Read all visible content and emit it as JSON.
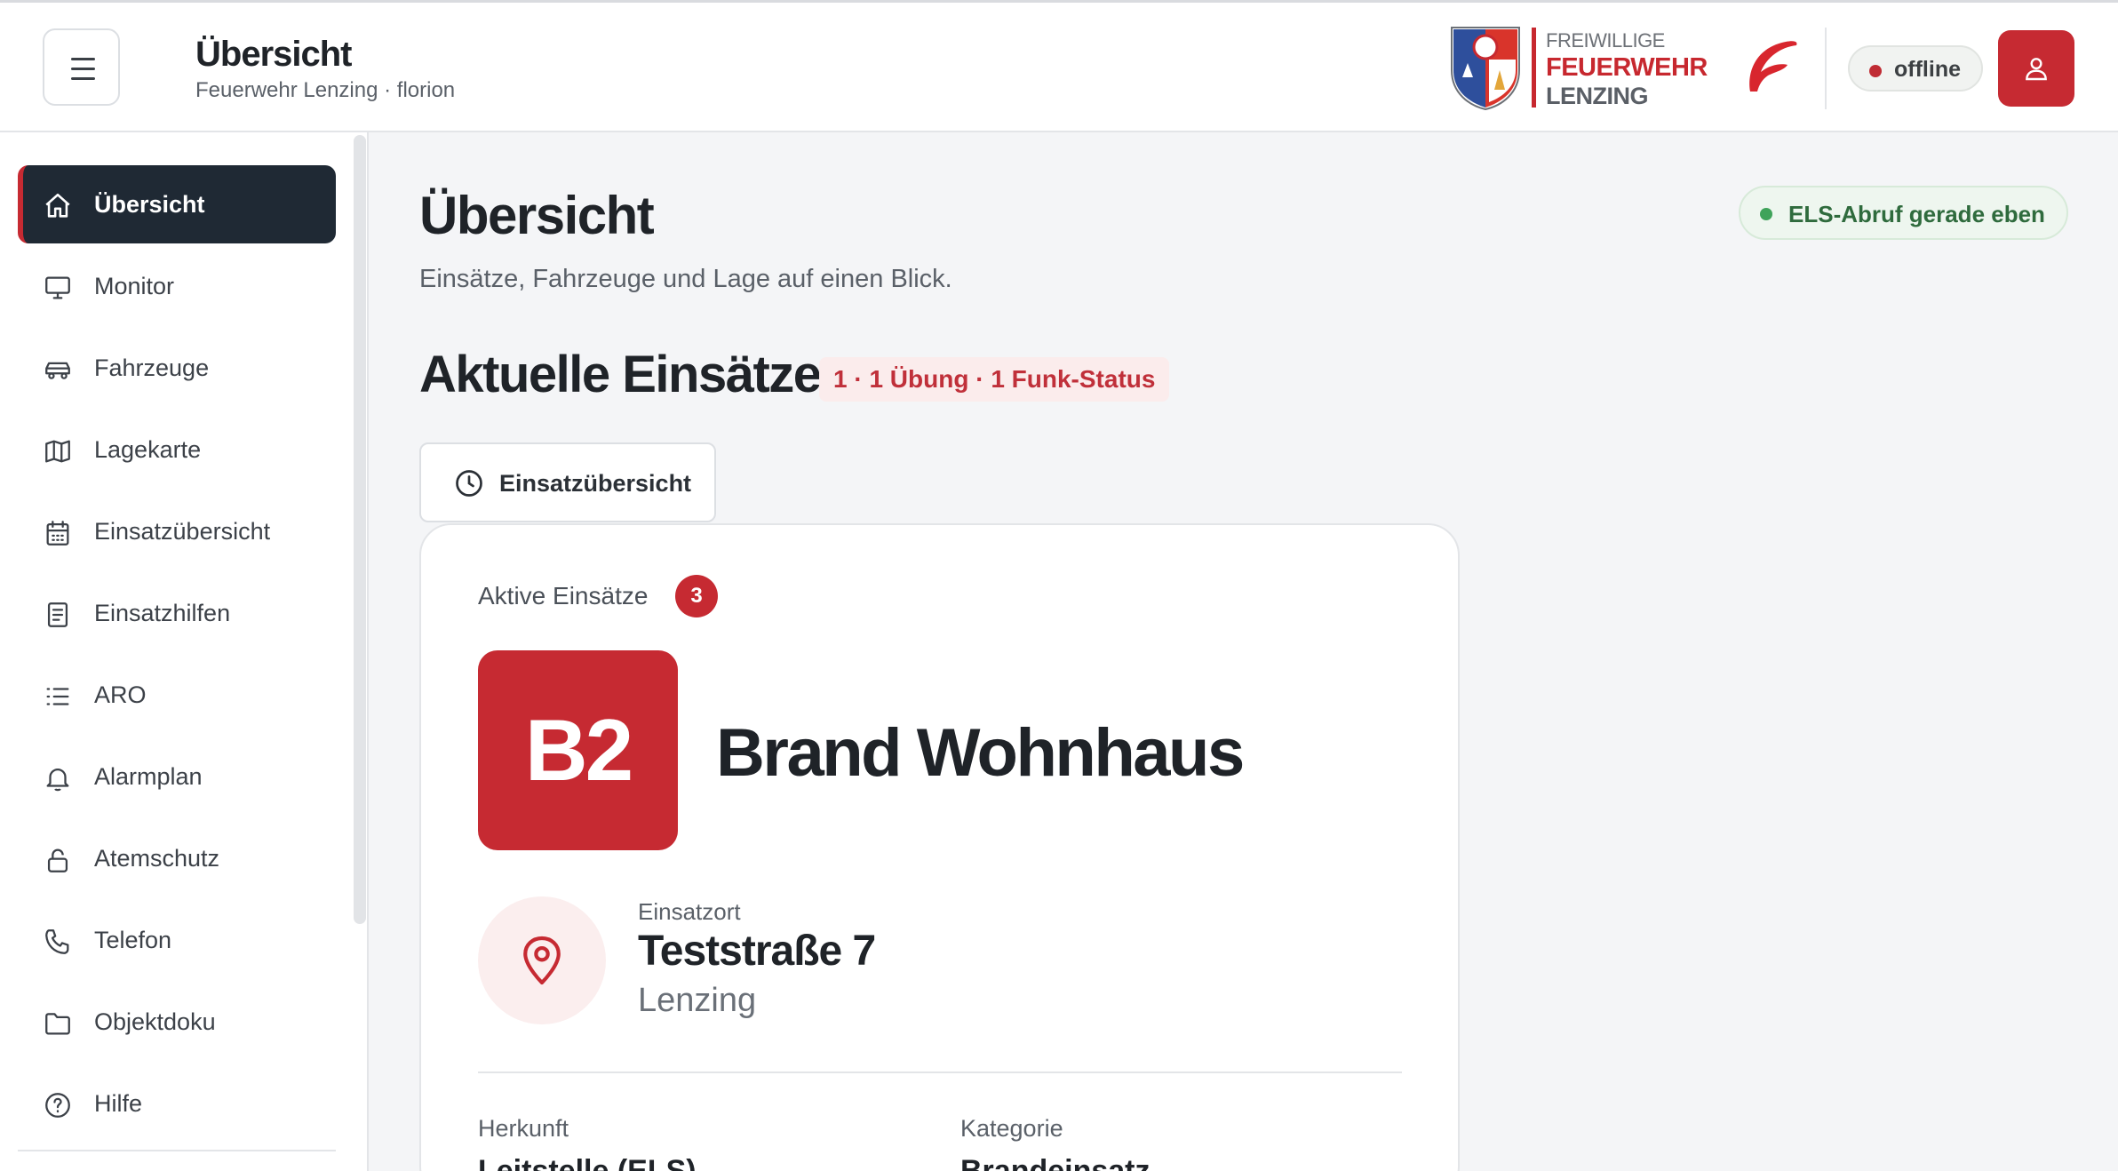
{
  "header": {
    "title": "Übersicht",
    "subtitle": "Feuerwehr Lenzing · florion",
    "brand": {
      "line1": "FREIWILLIGE",
      "line2": "FEUERWEHR",
      "line3": "LENZING"
    },
    "status": "offline",
    "icons": {
      "menu": "menu-icon",
      "user": "user-icon",
      "flame_logo": "florion-logo"
    }
  },
  "sidebar": {
    "items": [
      {
        "label": "Übersicht",
        "icon": "home-icon",
        "active": true
      },
      {
        "label": "Monitor",
        "icon": "monitor-icon",
        "active": false
      },
      {
        "label": "Fahrzeuge",
        "icon": "car-icon",
        "active": false
      },
      {
        "label": "Lagekarte",
        "icon": "map-icon",
        "active": false
      },
      {
        "label": "Einsatzübersicht",
        "icon": "calendar-icon",
        "active": false
      },
      {
        "label": "Einsatzhilfen",
        "icon": "document-icon",
        "active": false
      },
      {
        "label": "ARO",
        "icon": "list-icon",
        "active": false
      },
      {
        "label": "Alarmplan",
        "icon": "bell-icon",
        "active": false
      },
      {
        "label": "Atemschutz",
        "icon": "lock-icon",
        "active": false
      },
      {
        "label": "Telefon",
        "icon": "phone-icon",
        "active": false
      },
      {
        "label": "Objektdoku",
        "icon": "folder-icon",
        "active": false
      },
      {
        "label": "Hilfe",
        "icon": "help-icon",
        "active": false
      }
    ]
  },
  "main": {
    "title": "Übersicht",
    "subtitle": "Einsätze, Fahrzeuge und Lage auf einen Blick.",
    "els_status": "ELS-Abruf gerade eben",
    "section_title": "Aktuelle Einsätze",
    "section_badge": "1 · 1 Übung · 1 Funk-Status",
    "tab_label": "Einsatzübersicht",
    "card": {
      "label": "Aktive Einsätze",
      "count": "3",
      "code": "B2",
      "incident_title": "Brand Wohnhaus",
      "location_label": "Einsatzort",
      "street": "Teststraße 7",
      "city": "Lenzing",
      "origin_label": "Herkunft",
      "origin_value": "Leitstelle (ELS)",
      "category_label": "Kategorie",
      "category_value": "Brandeinsatz"
    }
  },
  "colors": {
    "accent": "#c62a32",
    "sidebar_active_bg": "#1f2934",
    "success": "#3fa35a",
    "page_bg": "#f4f5f7"
  }
}
